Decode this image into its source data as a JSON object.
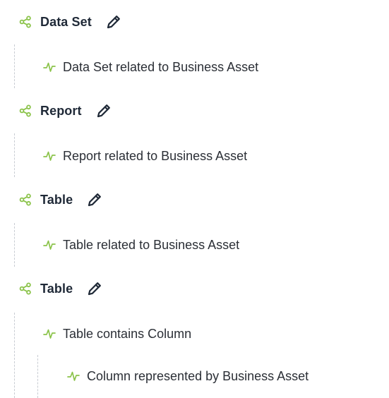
{
  "colors": {
    "accent_green": "#8bc34a",
    "icon_dark": "#1f2937",
    "text": "#2b2f36",
    "guide_line": "#c8ccd2"
  },
  "icons": {
    "group": "share-nodes-icon",
    "edit": "pencil-icon",
    "relation": "pulse-icon"
  },
  "groups": [
    {
      "title": "Data Set",
      "relations": [
        "Data Set related to Business Asset"
      ]
    },
    {
      "title": "Report",
      "relations": [
        "Report related to Business Asset"
      ]
    },
    {
      "title": "Table",
      "relations": [
        "Table related to Business Asset"
      ]
    },
    {
      "title": "Table",
      "relations": [
        "Table contains Column"
      ],
      "nested_relations": [
        "Column represented by Business Asset"
      ]
    }
  ]
}
